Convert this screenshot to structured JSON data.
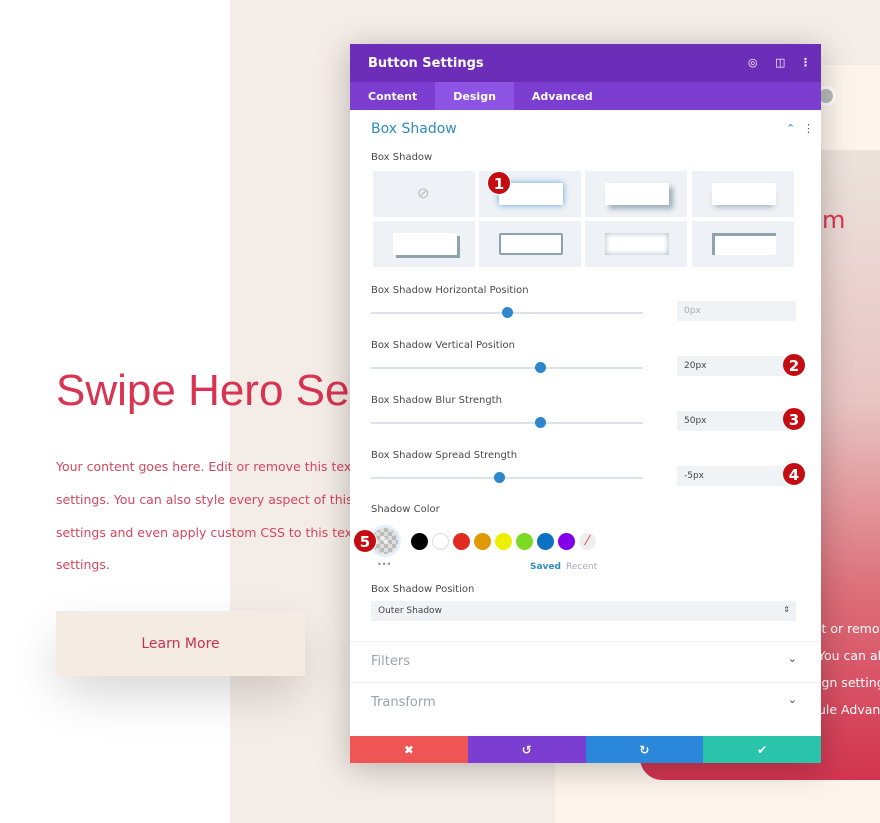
{
  "page": {
    "hero_title": "Swipe Hero Se",
    "hero_lines": [
      "Your content goes here. Edit or remove this text inli",
      "settings. You can also style every aspect of this con",
      "settings and even apply custom CSS to this text in t",
      "settings."
    ],
    "button": "Learn More",
    "right_heading": "m",
    "right_lines": [
      "it or remov",
      "You can als",
      "ign setting",
      "ule Advanc"
    ]
  },
  "modal": {
    "title": "Button Settings",
    "tabs": [
      "Content",
      "Design",
      "Advanced"
    ],
    "active_tab": "Design",
    "section": "Box Shadow",
    "box_shadow_label": "Box Shadow",
    "sliders": [
      {
        "label": "Box Shadow Horizontal Position",
        "value": "0px",
        "fraction": 0.5
      },
      {
        "label": "Box Shadow Vertical Position",
        "value": "20px",
        "fraction": 0.62
      },
      {
        "label": "Box Shadow Blur Strength",
        "value": "50px",
        "fraction": 0.62
      },
      {
        "label": "Box Shadow Spread Strength",
        "value": "-5px",
        "fraction": 0.47
      }
    ],
    "shadow_color_label": "Shadow Color",
    "swatches": [
      "#000000",
      "#ffffff",
      "#e02b20",
      "#e09900",
      "#edf000",
      "#7cda24",
      "#0c71c3",
      "#8300e9"
    ],
    "saved": "Saved",
    "recent": "Recent",
    "more": "•••",
    "position_label": "Box Shadow Position",
    "position_value": "Outer Shadow",
    "collapsed": [
      "Filters",
      "Transform"
    ],
    "badges": [
      "1",
      "2",
      "3",
      "4",
      "5"
    ],
    "footer_icons": [
      "close-icon",
      "undo-icon",
      "redo-icon",
      "check-icon"
    ],
    "footer_glyphs": [
      "✖",
      "↺",
      "↻",
      "✔"
    ],
    "colors": {
      "header": "#6c2eb9",
      "tabs": "#7c3dd1",
      "accent": "#2e8bc0",
      "cancel": "#ef5555",
      "undo": "#7c3dd1",
      "redo": "#2b87da",
      "save": "#29c4a9",
      "hero": "#d83350"
    }
  }
}
